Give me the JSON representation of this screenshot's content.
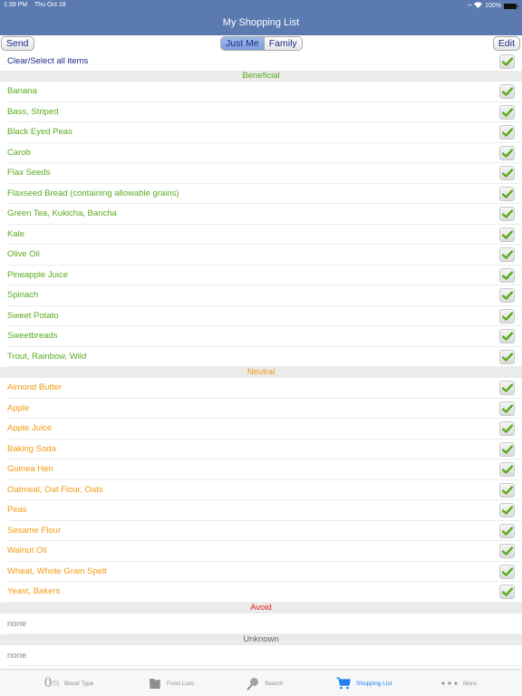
{
  "status": {
    "time": "1:39 PM",
    "date": "Thu Oct 18",
    "battery": "100%"
  },
  "nav": {
    "title": "My Shopping List"
  },
  "toolbar": {
    "send_label": "Send",
    "edit_label": "Edit",
    "segments": [
      {
        "label": "Just Me",
        "active": true
      },
      {
        "label": "Family",
        "active": false
      }
    ]
  },
  "clear_all": {
    "label": "Clear/Select all items",
    "checked": true
  },
  "colors": {
    "beneficial": "#5aab1e",
    "neutral": "#f39a12",
    "avoid": "#e8201d",
    "unknown": "#666666",
    "nav": "#5a7ab0",
    "accent": "#1e7ff0"
  },
  "sections": {
    "beneficial": {
      "title": "Beneficial",
      "items": [
        "Banana",
        "Bass, Striped",
        "Black Eyed Peas",
        "Carob",
        "Flax Seeds",
        "Flaxseed Bread (containing allowable grains)",
        "Green Tea, Kukicha, Bancha",
        "Kale",
        "Olive Oil",
        "Pineapple Juice",
        "Spinach",
        "Sweet Potato",
        "Sweetbreads",
        "Trout, Rainbow, Wild"
      ]
    },
    "neutral": {
      "title": "Neutral",
      "items": [
        "Almond Butter",
        "Apple",
        "Apple Juice",
        "Baking Soda",
        "Guinea Hen",
        "Oatmeal, Oat Flour, Oats",
        "Peas",
        "Sesame Flour",
        "Walnut Oil",
        "Wheat, Whole Grain Spelt",
        "Yeast, Bakers"
      ]
    },
    "avoid": {
      "title": "Avoid",
      "empty_label": "none"
    },
    "unknown": {
      "title": "Unknown",
      "empty_label": "none"
    }
  },
  "tabbar": {
    "blood_count": "0",
    "blood_sub": "(S)",
    "items": [
      {
        "label": "Blood Type",
        "icon": "blood-type-counter",
        "active": false
      },
      {
        "label": "Food Lists",
        "icon": "folder-icon",
        "active": false
      },
      {
        "label": "Search",
        "icon": "magnifier-icon",
        "active": false
      },
      {
        "label": "Shopping List",
        "icon": "cart-icon",
        "active": true
      },
      {
        "label": "More",
        "icon": "more-dots-icon",
        "active": false
      }
    ]
  }
}
